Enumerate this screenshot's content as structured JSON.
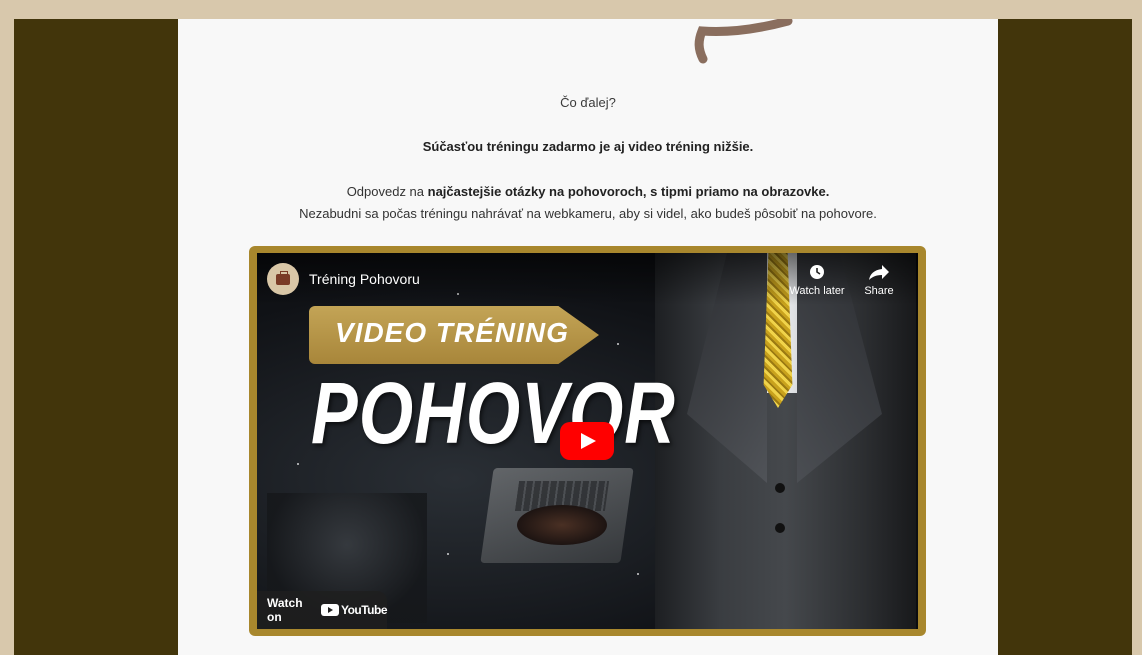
{
  "content": {
    "what_next": "Čo ďalej?",
    "part_of": "Súčasťou tréningu zadarmo je aj video tréning nižšie.",
    "answer_prefix": "Odpovedz na ",
    "answer_bold": "najčastejšie otázky na pohovoroch, s tipmi priamo na obrazovke.",
    "answer_line2": "Nezabudni sa počas tréningu nahrávať na webkameru, aby si videl, ako budeš pôsobiť na pohovore."
  },
  "video": {
    "title": "Tréning Pohovoru",
    "banner_text": "VIDEO TRÉNING",
    "big_text": "POHOVOR",
    "watch_later_label": "Watch later",
    "share_label": "Share",
    "watch_on_label": "Watch on",
    "youtube_label": "YouTube"
  },
  "colors": {
    "outer_bg": "#d8c8ac",
    "frame_bg": "#42350b",
    "page_bg": "#f8f8f8",
    "video_border": "#a8872d",
    "play_button": "#ff0000"
  },
  "icons": {
    "arrow": "arrow-decoration-icon",
    "clock": "clock-icon",
    "share": "share-icon",
    "play": "play-icon",
    "youtube": "youtube-logo-icon"
  }
}
